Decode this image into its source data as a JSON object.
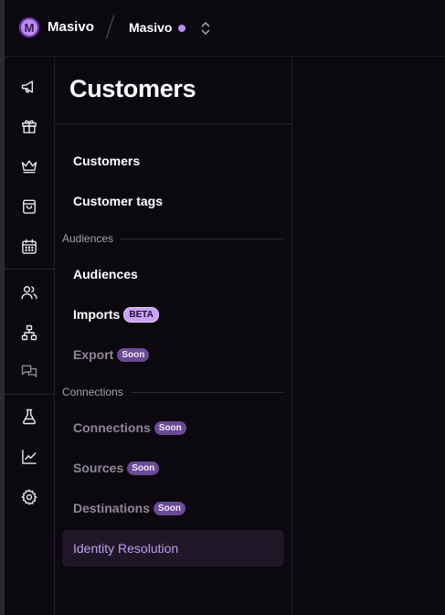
{
  "topbar": {
    "logo_letter": "M",
    "org_name": "Masivo",
    "workspace_name": "Masivo",
    "colors": {
      "accent": "#b98ee8",
      "background": "#0c0810"
    }
  },
  "rail": {
    "items": [
      {
        "icon": "megaphone-icon"
      },
      {
        "icon": "gift-icon"
      },
      {
        "icon": "crown-icon"
      },
      {
        "icon": "shopping-bag-icon"
      },
      {
        "icon": "calendar-icon"
      },
      {
        "icon": "users-icon"
      },
      {
        "icon": "hierarchy-icon"
      },
      {
        "icon": "chat-bubbles-icon"
      },
      {
        "icon": "flask-icon"
      },
      {
        "icon": "line-chart-icon"
      },
      {
        "icon": "gear-icon"
      }
    ]
  },
  "panel": {
    "title": "Customers",
    "items": {
      "customers": "Customers",
      "customer_tags": "Customer tags",
      "audiences": "Audiences",
      "imports": "Imports",
      "imports_badge": "BETA",
      "export": "Export",
      "export_badge": "Soon",
      "connections": "Connections",
      "connections_badge": "Soon",
      "sources": "Sources",
      "sources_badge": "Soon",
      "destinations": "Destinations",
      "destinations_badge": "Soon",
      "identity_resolution": "Identity Resolution"
    },
    "sections": {
      "audiences": "Audiences",
      "connections": "Connections"
    },
    "active_item": "Identity Resolution"
  }
}
